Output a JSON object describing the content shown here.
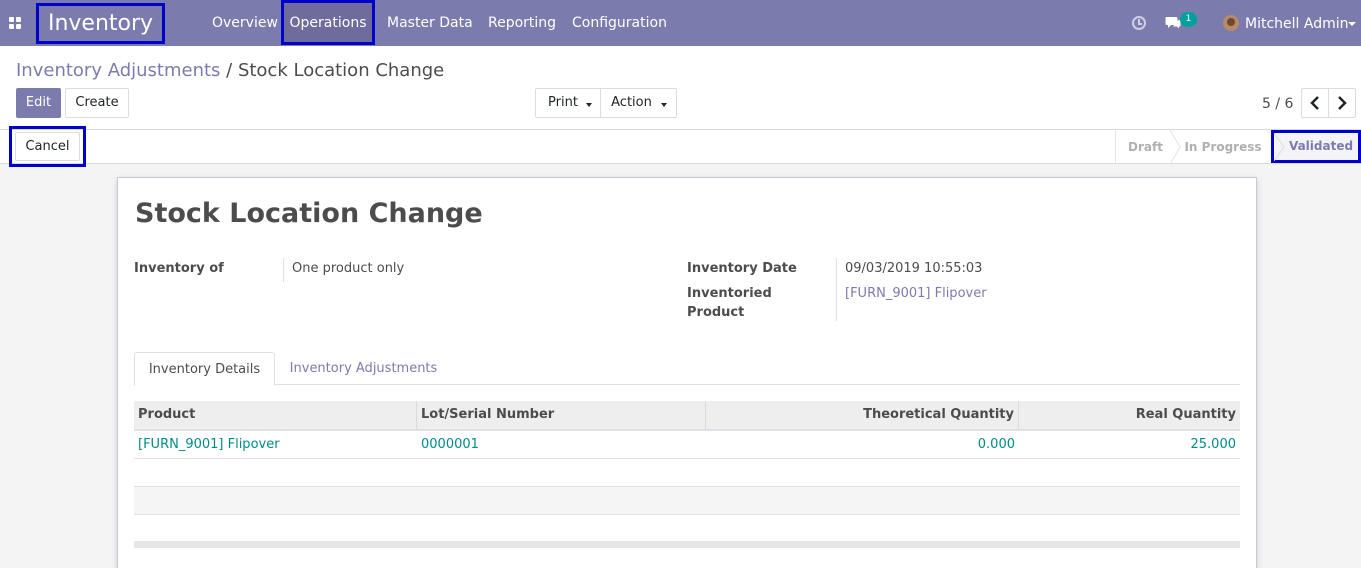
{
  "navbar": {
    "brand": "Inventory",
    "menu": [
      "Overview",
      "Operations",
      "Master Data",
      "Reporting",
      "Configuration"
    ],
    "chat_count": "1",
    "user_name": "Mitchell Admin"
  },
  "breadcrumb": {
    "parent": "Inventory Adjustments",
    "separator": " / ",
    "current": "Stock Location Change"
  },
  "buttons": {
    "edit": "Edit",
    "create": "Create",
    "print": "Print",
    "action": "Action",
    "cancel": "Cancel"
  },
  "pager": {
    "value": "5 / 6"
  },
  "statusbar": {
    "stages": [
      "Draft",
      "In Progress",
      "Validated"
    ],
    "current": "Validated"
  },
  "form": {
    "title": "Stock Location Change",
    "inventory_of_label": "Inventory of",
    "inventory_of_value": "One product only",
    "inventory_date_label": "Inventory Date",
    "inventory_date_value": "09/03/2019 10:55:03",
    "inventoried_product_label_1": "Inventoried",
    "inventoried_product_label_2": "Product",
    "inventoried_product_value": "[FURN_9001] Flipover"
  },
  "tabs": [
    "Inventory Details",
    "Inventory Adjustments"
  ],
  "table": {
    "headers": [
      "Product",
      "Lot/Serial Number",
      "Theoretical Quantity",
      "Real Quantity"
    ],
    "rows": [
      {
        "product": "[FURN_9001] Flipover",
        "lot": "0000001",
        "theoretical": "0.000",
        "real": "25.000"
      }
    ]
  },
  "colors": {
    "brand": "#7c7bad",
    "highlight": "#0000cc",
    "link_teal": "#008b8b"
  }
}
